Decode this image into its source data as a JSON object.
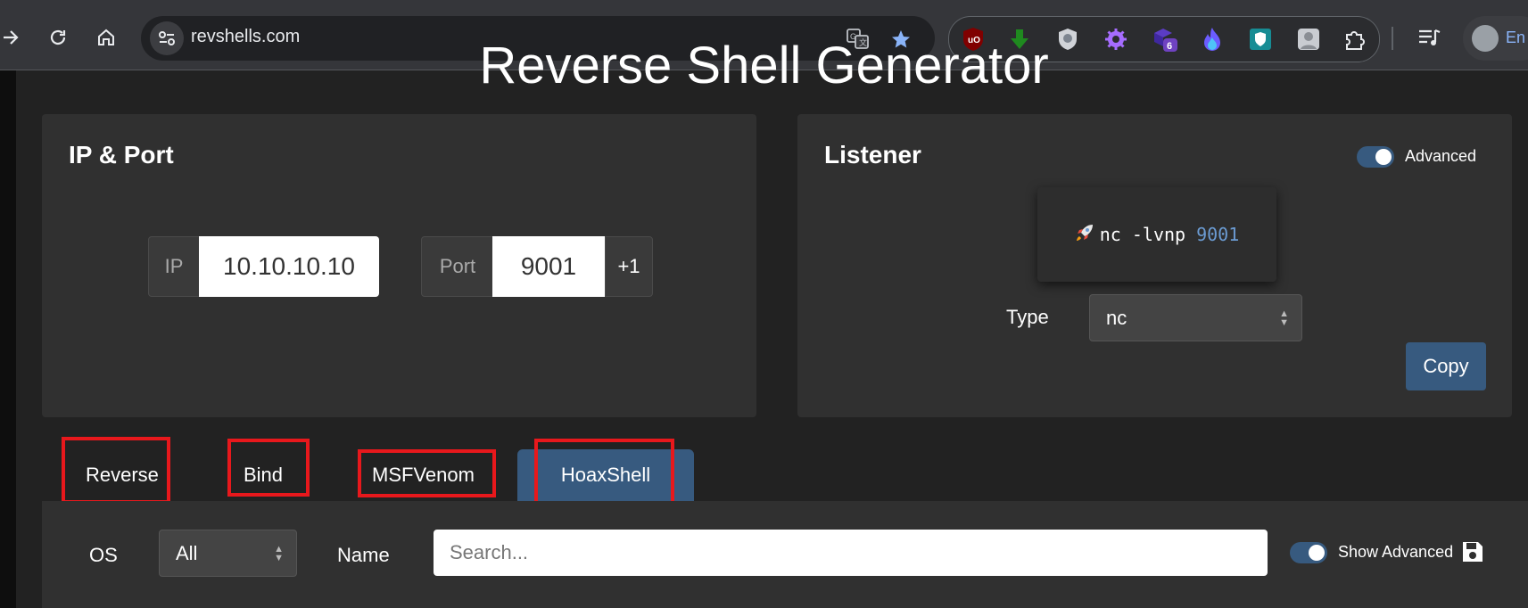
{
  "browser": {
    "url": "revshells.com",
    "profile_label": "En",
    "extensions": [
      {
        "name": "ublock-origin-icon",
        "badge": ""
      },
      {
        "name": "download-arrow-icon",
        "badge": ""
      },
      {
        "name": "shield-extension-icon",
        "badge": ""
      },
      {
        "name": "gear-extension-icon",
        "badge": ""
      },
      {
        "name": "purple-cube-extension-icon",
        "badge": "6"
      },
      {
        "name": "flame-extension-icon",
        "badge": ""
      },
      {
        "name": "bitwarden-icon",
        "badge": ""
      },
      {
        "name": "image-extension-icon",
        "badge": ""
      }
    ]
  },
  "page": {
    "title": "Reverse Shell Generator"
  },
  "ip_port": {
    "title": "IP & Port",
    "ip_label": "IP",
    "ip_value": "10.10.10.10",
    "port_label": "Port",
    "port_value": "9001",
    "increment_label": "+1"
  },
  "listener": {
    "title": "Listener",
    "advanced_label": "Advanced",
    "advanced_on": true,
    "command_prefix": "nc -lvnp",
    "command_port": "9001",
    "type_label": "Type",
    "type_value": "nc",
    "copy_label": "Copy"
  },
  "tabs": [
    {
      "label": "Reverse",
      "active": false
    },
    {
      "label": "Bind",
      "active": false
    },
    {
      "label": "MSFVenom",
      "active": false
    },
    {
      "label": "HoaxShell",
      "active": true
    }
  ],
  "filters": {
    "os_label": "OS",
    "os_value": "All",
    "name_label": "Name",
    "search_placeholder": "Search...",
    "show_advanced_label": "Show Advanced",
    "show_advanced_on": true
  },
  "colors": {
    "accent": "#375a7f",
    "highlight": "#e8181c",
    "port_text": "#6b9bd2"
  }
}
